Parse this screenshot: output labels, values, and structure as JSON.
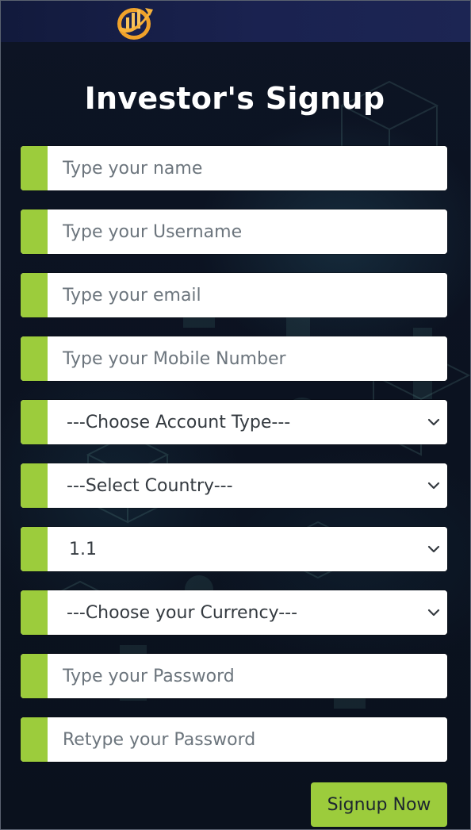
{
  "header": {
    "logo_icon": "bar-chart-coin-logo-icon",
    "title": "Investor's Signup"
  },
  "form": {
    "name_placeholder": "Type your name",
    "username_placeholder": "Type your Username",
    "email_placeholder": "Type your email",
    "mobile_placeholder": "Type your Mobile Number",
    "account_type_selected": "---Choose Account Type---",
    "country_selected": "---Select Country---",
    "plan_selected": "1.1",
    "currency_selected": "---Choose your Currency---",
    "password_placeholder": "Type your Password",
    "retype_password_placeholder": "Retype your Password",
    "submit_label": "Signup Now"
  },
  "colors": {
    "accent_green": "#9ccc3c",
    "page_background": "#0c1322",
    "topbar_background": "#1a2250",
    "logo_orange": "#f0a22a"
  }
}
